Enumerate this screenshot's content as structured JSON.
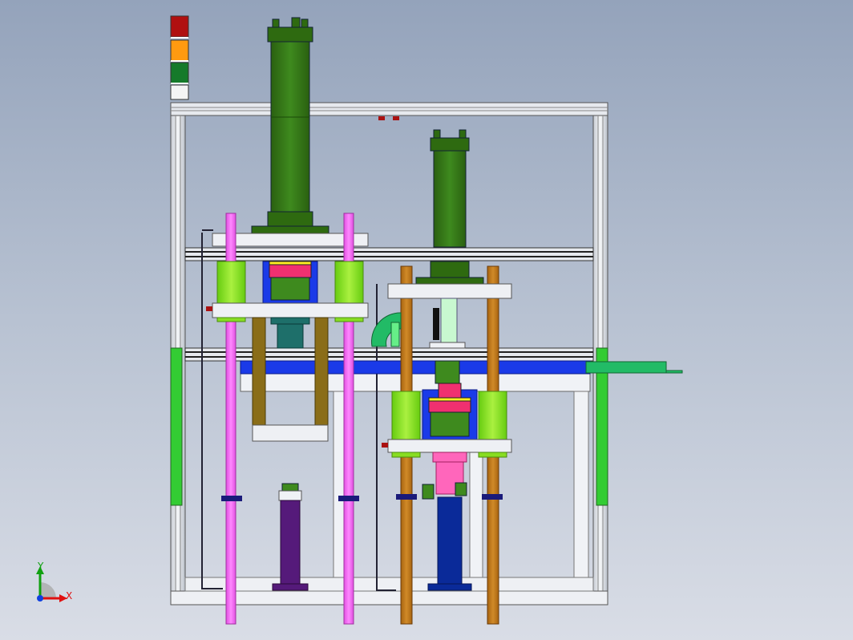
{
  "view": {
    "background_top": "#94a3bb",
    "background_bottom": "#d9dde6"
  },
  "triad": {
    "x_label": "X",
    "y_label": "Y",
    "x_color": "#e01010",
    "y_color": "#10a010",
    "z_color": "#1040e0"
  },
  "signal_tower": {
    "lamps": [
      "red",
      "orange",
      "green",
      "white"
    ]
  },
  "colors": {
    "frame": "#e6e9ee",
    "frame_edge": "#707880",
    "plate": "#eef0f4",
    "cylinder_dark": "#2e6a10",
    "cylinder": "#3e8a1e",
    "guide_pink": "#ee66ee",
    "guide_brown": "#c07818",
    "bushing": "#88dd22",
    "blue_plate": "#1a3ae8",
    "magenta_block": "#f03070",
    "purple_post": "#551a7a",
    "navy_post": "#0a2a99",
    "teal_block": "#1e6f6a",
    "olive_leg": "#8a6d18",
    "conveyor_green": "#22bb66",
    "side_panel_green": "#33cc33"
  }
}
